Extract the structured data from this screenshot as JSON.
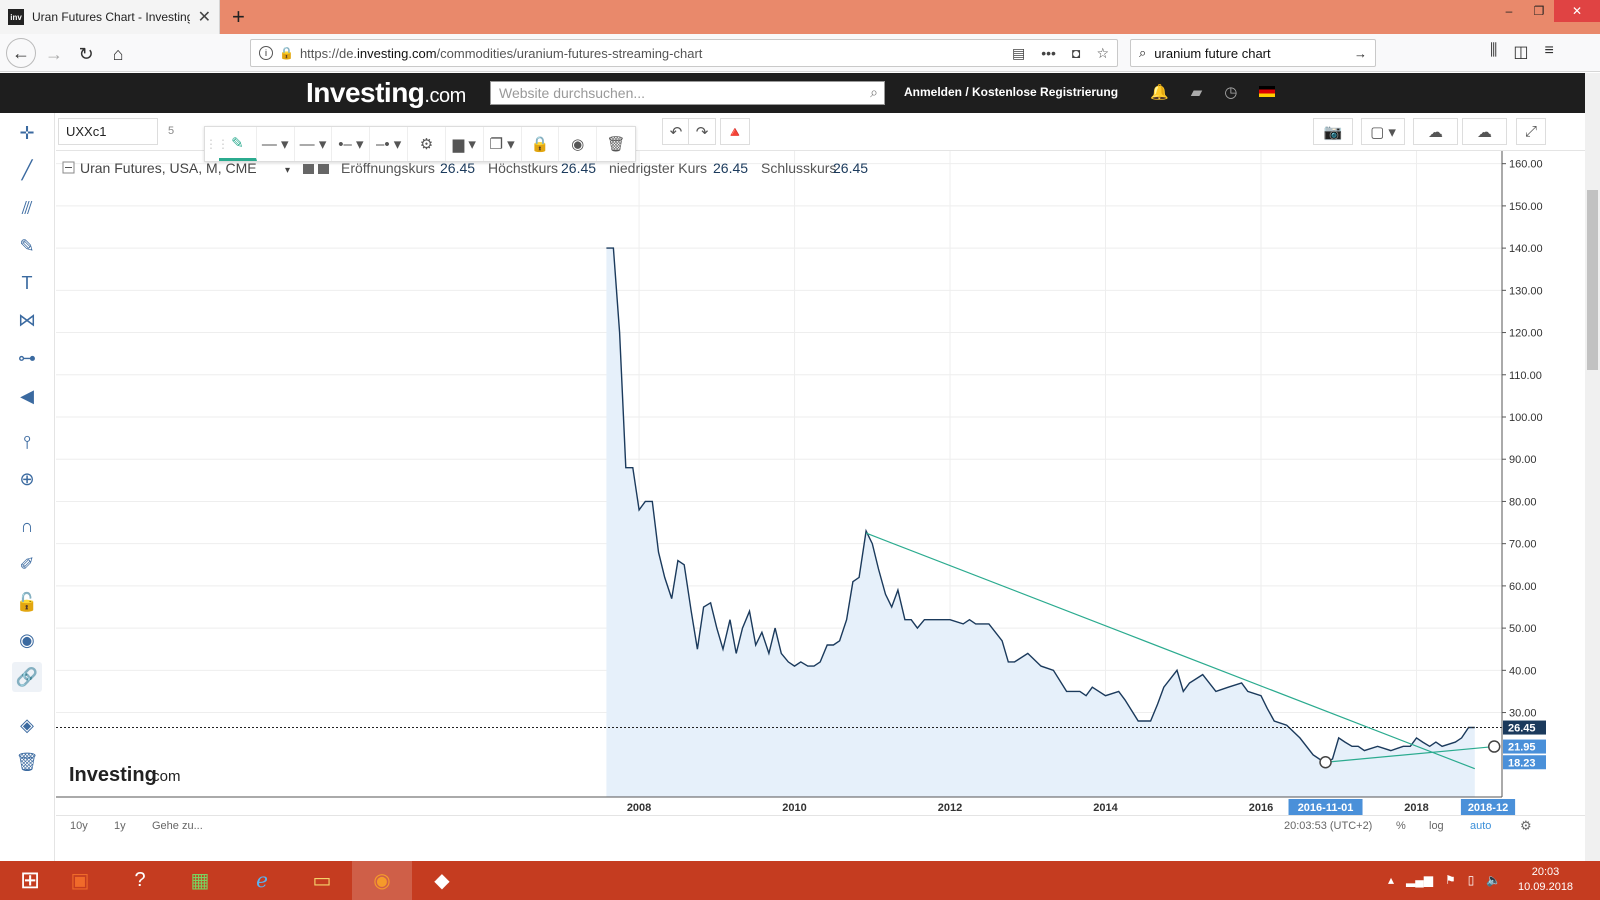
{
  "browser": {
    "tab_title": "Uran Futures Chart - Investing.c",
    "tab_favicon": "inv",
    "url_prefix": "https://de.",
    "url_domain": "investing.com",
    "url_path": "/commodities/uranium-futures-streaming-chart",
    "search_query": "uranium future chart"
  },
  "site": {
    "logo_main": "Investing",
    "logo_suffix": ".com",
    "search_placeholder": "Website durchsuchen...",
    "auth_text": "Anmelden / Kostenlose Registrierung"
  },
  "toolbar": {
    "symbol": "UXXc1",
    "interval": "5"
  },
  "legend": {
    "title": "Uran Futures, USA, M, CME",
    "open_label": "Eröffnungskurs",
    "open_value": "26.45",
    "high_label": "Höchstkurs",
    "high_value": "26.45",
    "low_label": "niedrigster Kurs",
    "low_value": "26.45",
    "close_label": "Schlusskurs",
    "close_value": "26.45"
  },
  "watermark": {
    "main": "Investing",
    "suffix": ".com"
  },
  "bottom": {
    "range_10y": "10y",
    "range_1y": "1y",
    "goto": "Gehe zu...",
    "time": "20:03:53 (UTC+2)",
    "pct": "%",
    "log": "log",
    "auto": "auto"
  },
  "taskbar": {
    "clock_time": "20:03",
    "clock_date": "10.09.2018"
  },
  "colors": {
    "line": "#1b3a5c",
    "area_fill": "#e6f0fa",
    "trend": "#2bab8f",
    "price_tag": "#1b3a5c",
    "marker_tag": "#4a90d9"
  },
  "chart_data": {
    "type": "area",
    "ylim": [
      10,
      163
    ],
    "y_ticks": [
      "160.00",
      "150.00",
      "140.00",
      "130.00",
      "120.00",
      "110.00",
      "100.00",
      "90.00",
      "80.00",
      "70.00",
      "60.00",
      "50.00",
      "40.00",
      "30.00"
    ],
    "x_ticks": [
      {
        "label": "2008",
        "x": 2008.0
      },
      {
        "label": "2010",
        "x": 2010.0
      },
      {
        "label": "2012",
        "x": 2012.0
      },
      {
        "label": "2014",
        "x": 2014.0
      },
      {
        "label": "2016",
        "x": 2016.0
      },
      {
        "label": "2018",
        "x": 2018.0
      }
    ],
    "x_range": [
      2000.5,
      2019.1
    ],
    "x_highlight_labels": [
      "2016-11-01",
      "2018-12"
    ],
    "x_highlight_values": [
      2016.83,
      2018.92
    ],
    "price_labels": [
      {
        "label": "26.45",
        "value": 26.45,
        "style": "dark"
      },
      {
        "label": "21.95",
        "value": 21.95,
        "style": "blue"
      },
      {
        "label": "18.23",
        "value": 18.23,
        "style": "blue"
      }
    ],
    "current_price": 26.45,
    "series": [
      {
        "name": "Uran Futures",
        "points": [
          [
            2007.58,
            140
          ],
          [
            2007.67,
            140
          ],
          [
            2007.75,
            120
          ],
          [
            2007.83,
            88
          ],
          [
            2007.92,
            88
          ],
          [
            2008.0,
            78
          ],
          [
            2008.08,
            80
          ],
          [
            2008.17,
            80
          ],
          [
            2008.25,
            68
          ],
          [
            2008.33,
            62
          ],
          [
            2008.42,
            57
          ],
          [
            2008.5,
            66
          ],
          [
            2008.58,
            65
          ],
          [
            2008.67,
            54
          ],
          [
            2008.75,
            45
          ],
          [
            2008.83,
            55
          ],
          [
            2008.92,
            56
          ],
          [
            2009.0,
            50
          ],
          [
            2009.08,
            45
          ],
          [
            2009.17,
            52
          ],
          [
            2009.25,
            44
          ],
          [
            2009.33,
            50
          ],
          [
            2009.42,
            54
          ],
          [
            2009.5,
            46
          ],
          [
            2009.58,
            49
          ],
          [
            2009.67,
            44
          ],
          [
            2009.75,
            50
          ],
          [
            2009.83,
            44
          ],
          [
            2009.92,
            42
          ],
          [
            2010.0,
            41
          ],
          [
            2010.08,
            42
          ],
          [
            2010.17,
            41
          ],
          [
            2010.25,
            41
          ],
          [
            2010.33,
            42
          ],
          [
            2010.42,
            46
          ],
          [
            2010.5,
            46
          ],
          [
            2010.58,
            47
          ],
          [
            2010.67,
            52
          ],
          [
            2010.75,
            61
          ],
          [
            2010.83,
            62
          ],
          [
            2010.92,
            73
          ],
          [
            2011.0,
            70
          ],
          [
            2011.08,
            64
          ],
          [
            2011.17,
            58
          ],
          [
            2011.25,
            55
          ],
          [
            2011.33,
            59
          ],
          [
            2011.42,
            52
          ],
          [
            2011.5,
            52
          ],
          [
            2011.58,
            50
          ],
          [
            2011.67,
            52
          ],
          [
            2011.83,
            52
          ],
          [
            2012.0,
            52
          ],
          [
            2012.17,
            51
          ],
          [
            2012.25,
            52
          ],
          [
            2012.33,
            51
          ],
          [
            2012.5,
            51
          ],
          [
            2012.67,
            47
          ],
          [
            2012.75,
            42
          ],
          [
            2012.83,
            42
          ],
          [
            2013.0,
            44
          ],
          [
            2013.17,
            41
          ],
          [
            2013.33,
            40
          ],
          [
            2013.5,
            35
          ],
          [
            2013.67,
            35
          ],
          [
            2013.75,
            34
          ],
          [
            2013.83,
            36
          ],
          [
            2014.0,
            34
          ],
          [
            2014.17,
            35
          ],
          [
            2014.25,
            33
          ],
          [
            2014.42,
            28
          ],
          [
            2014.58,
            28
          ],
          [
            2014.67,
            32
          ],
          [
            2014.75,
            36
          ],
          [
            2014.92,
            40
          ],
          [
            2015.0,
            35
          ],
          [
            2015.08,
            37
          ],
          [
            2015.25,
            39
          ],
          [
            2015.42,
            35
          ],
          [
            2015.58,
            36
          ],
          [
            2015.75,
            37
          ],
          [
            2015.83,
            35
          ],
          [
            2016.0,
            34
          ],
          [
            2016.08,
            31
          ],
          [
            2016.17,
            28
          ],
          [
            2016.33,
            27
          ],
          [
            2016.5,
            24
          ],
          [
            2016.67,
            20
          ],
          [
            2016.75,
            19
          ],
          [
            2016.83,
            18.23
          ],
          [
            2016.92,
            19
          ],
          [
            2017.0,
            24
          ],
          [
            2017.08,
            23
          ],
          [
            2017.17,
            22
          ],
          [
            2017.25,
            22
          ],
          [
            2017.33,
            21
          ],
          [
            2017.5,
            22
          ],
          [
            2017.67,
            21
          ],
          [
            2017.83,
            22
          ],
          [
            2017.92,
            22
          ],
          [
            2018.0,
            24
          ],
          [
            2018.08,
            23
          ],
          [
            2018.17,
            22
          ],
          [
            2018.25,
            23
          ],
          [
            2018.33,
            22
          ],
          [
            2018.5,
            23
          ],
          [
            2018.58,
            24
          ],
          [
            2018.67,
            26.45
          ],
          [
            2018.75,
            26.45
          ]
        ]
      }
    ],
    "trendlines": [
      {
        "from": [
          2010.92,
          72.5
        ],
        "to": [
          2018.75,
          16.7
        ]
      },
      {
        "from": [
          2016.83,
          18.23
        ],
        "to": [
          2019.0,
          21.95
        ]
      }
    ]
  }
}
